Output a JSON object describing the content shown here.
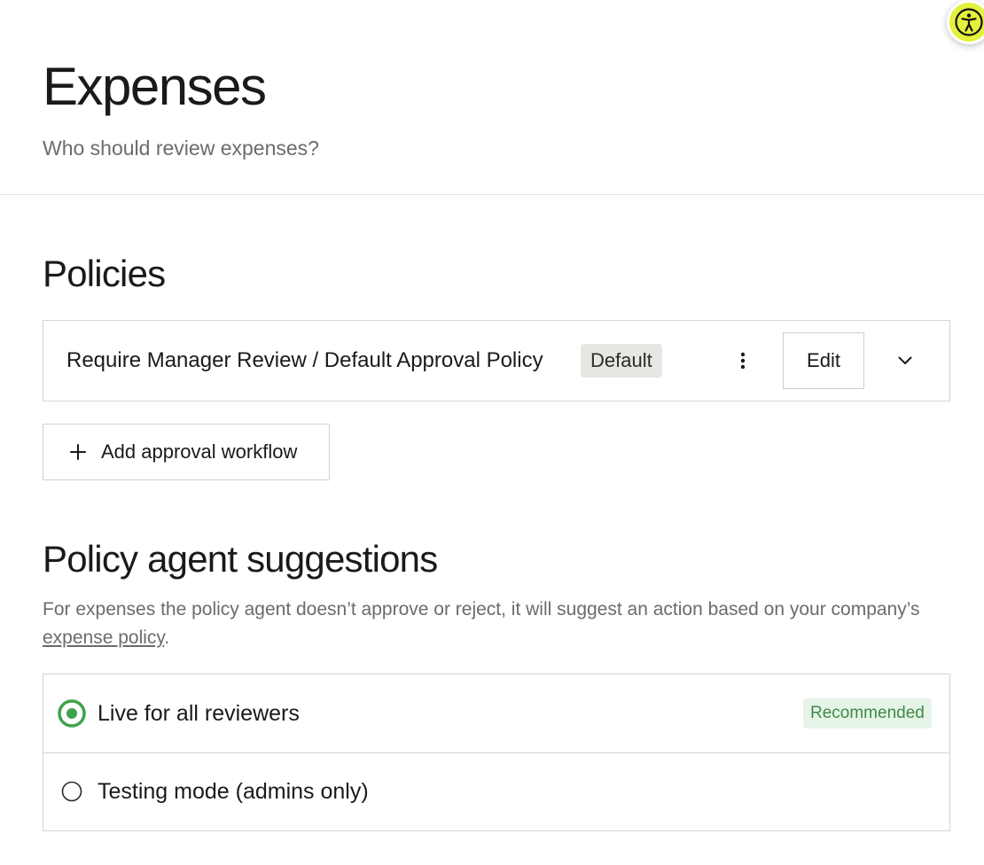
{
  "header": {
    "title": "Expenses",
    "subtitle": "Who should review expenses?"
  },
  "accessibility": {
    "icon": "accessibility-icon"
  },
  "policies": {
    "title": "Policies",
    "items": [
      {
        "name": "Require Manager Review / Default Approval Policy",
        "badge": "Default",
        "edit_label": "Edit"
      }
    ],
    "add_label": "Add approval workflow"
  },
  "agent": {
    "title": "Policy agent suggestions",
    "description_before": "For expenses the policy agent doesn’t approve or reject, it will suggest an action based on your company’s ",
    "description_link": "expense policy",
    "description_after": ".",
    "options": [
      {
        "label": "Live for all reviewers",
        "badge": "Recommended",
        "selected": true
      },
      {
        "label": "Testing mode (admins only)",
        "badge": "",
        "selected": false
      }
    ]
  },
  "colors": {
    "accent_green": "#3fa34d",
    "badge_green_bg": "#e6f4e7",
    "a11y_yellow": "#e3f03c"
  }
}
